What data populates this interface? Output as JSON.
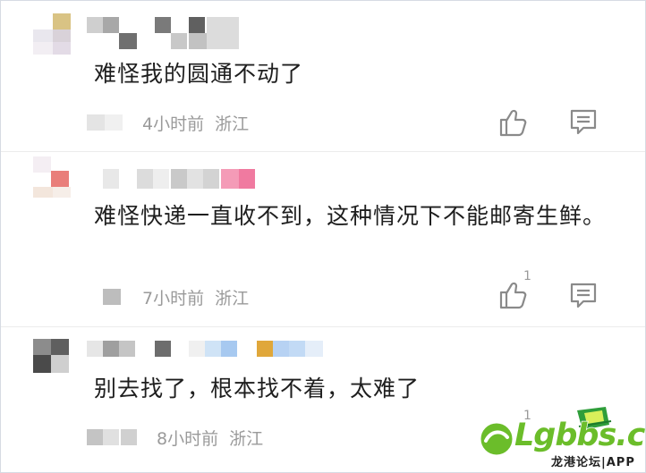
{
  "comments": [
    {
      "text": "难怪我的圆通不动了",
      "time": "4小时前",
      "region": "浙江",
      "likes": ""
    },
    {
      "text": "难怪快递一直收不到，这种情况下不能邮寄生鲜。",
      "time": "7小时前",
      "region": "浙江",
      "likes": "1"
    },
    {
      "text": "别去找了，根本找不着，太难了",
      "time": "8小时前",
      "region": "浙江",
      "likes": "1"
    }
  ],
  "icons": {
    "like": "thumbs-up-icon",
    "reply": "comment-icon"
  },
  "watermark": {
    "brand": "Lgbbs.cn",
    "tagline": "龙港论坛|APP"
  },
  "colors": {
    "meta_gray": "#9a9a9a",
    "text": "#1e1e1e",
    "icon_gray": "#8a8a8a",
    "watermark_green": "#6bbd2a"
  }
}
